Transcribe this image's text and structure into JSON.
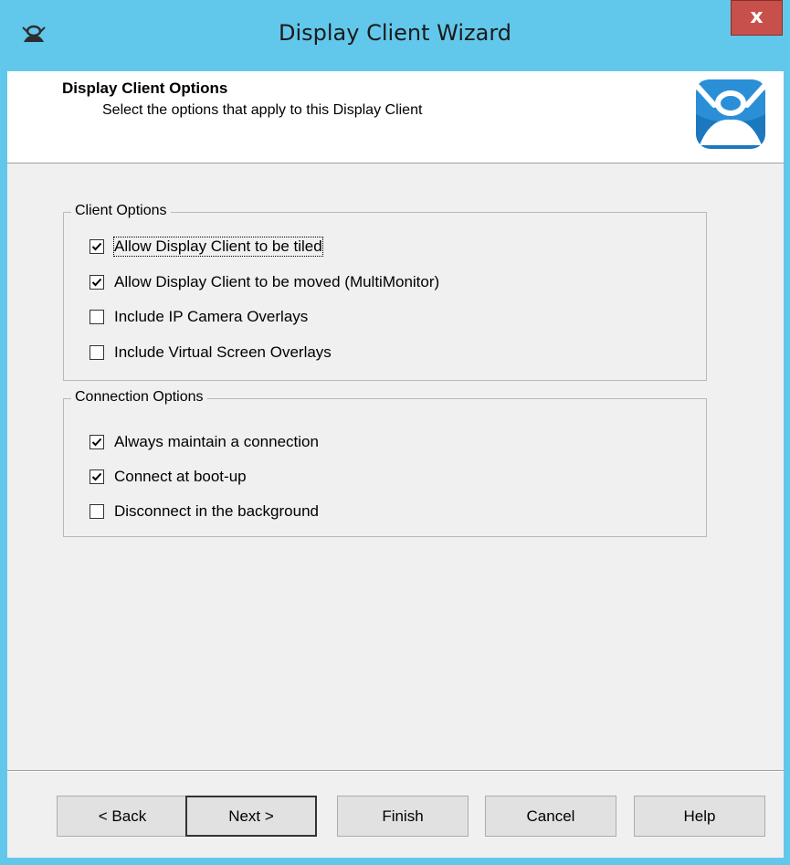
{
  "window": {
    "title": "Display Client Wizard",
    "close_label": "x",
    "title_icon": "thinmanager-icon",
    "close_color": "#c7504b",
    "titlebar_color": "#62c8eb"
  },
  "header": {
    "title": "Display Client Options",
    "subtitle": "Select the options that apply to this Display Client",
    "logo": "thinmanager-logo"
  },
  "client_options": {
    "legend": "Client Options",
    "items": [
      {
        "label": "Allow Display Client to be tiled",
        "checked": true,
        "focused": true
      },
      {
        "label": "Allow Display Client to be moved (MultiMonitor)",
        "checked": true,
        "focused": false
      },
      {
        "label": "Include IP Camera Overlays",
        "checked": false,
        "focused": false
      },
      {
        "label": "Include Virtual Screen Overlays",
        "checked": false,
        "focused": false
      }
    ]
  },
  "connection_options": {
    "legend": "Connection Options",
    "items": [
      {
        "label": "Always maintain a connection",
        "checked": true
      },
      {
        "label": "Connect at boot-up",
        "checked": true
      },
      {
        "label": "Disconnect in the background",
        "checked": false
      }
    ]
  },
  "buttons": {
    "back": "< Back",
    "next": "Next >",
    "finish": "Finish",
    "cancel": "Cancel",
    "help": "Help"
  }
}
